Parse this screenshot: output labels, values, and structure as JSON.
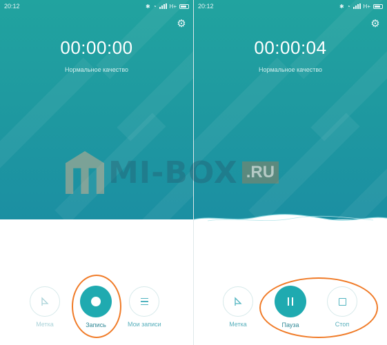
{
  "status_bar": {
    "time": "20:12",
    "network": "H+"
  },
  "left_screen": {
    "timer": "00:00:00",
    "quality": "Нормальное качество",
    "buttons": {
      "mark": "Метка",
      "record": "Запись",
      "my_records": "Мои записи"
    }
  },
  "right_screen": {
    "timer": "00:00:04",
    "quality": "Нормальное качество",
    "buttons": {
      "mark": "Метка",
      "pause": "Пауза",
      "stop": "Стоп"
    }
  },
  "watermark": {
    "brand": "MI-BOX",
    "tld": ".RU"
  },
  "icons": [
    "settings-gear-icon",
    "bluetooth-icon",
    "alarm-icon",
    "signal-icon",
    "battery-icon",
    "flag-icon",
    "record-icon",
    "list-icon",
    "pause-icon",
    "stop-icon"
  ],
  "colors": {
    "teal_background": "#1f9aa0",
    "accent": "#1faab0",
    "highlight_outline": "#f07a26"
  }
}
